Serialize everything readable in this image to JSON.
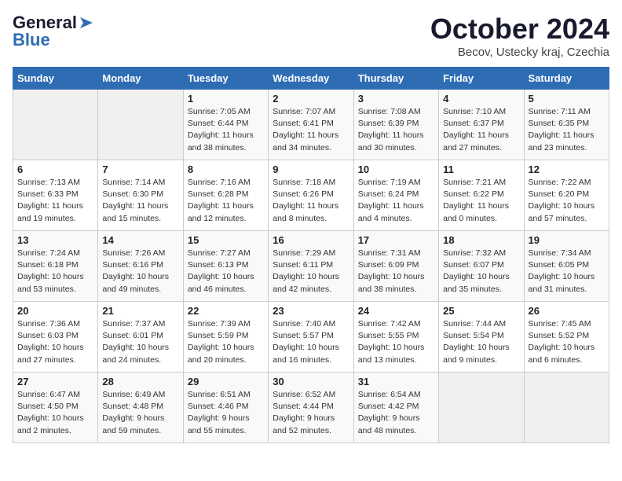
{
  "header": {
    "logo_line1": "General",
    "logo_line2": "Blue",
    "title": "October 2024",
    "subtitle": "Becov, Ustecky kraj, Czechia"
  },
  "days_of_week": [
    "Sunday",
    "Monday",
    "Tuesday",
    "Wednesday",
    "Thursday",
    "Friday",
    "Saturday"
  ],
  "weeks": [
    [
      {
        "day": "",
        "info": ""
      },
      {
        "day": "",
        "info": ""
      },
      {
        "day": "1",
        "info": "Sunrise: 7:05 AM\nSunset: 6:44 PM\nDaylight: 11 hours and 38 minutes."
      },
      {
        "day": "2",
        "info": "Sunrise: 7:07 AM\nSunset: 6:41 PM\nDaylight: 11 hours and 34 minutes."
      },
      {
        "day": "3",
        "info": "Sunrise: 7:08 AM\nSunset: 6:39 PM\nDaylight: 11 hours and 30 minutes."
      },
      {
        "day": "4",
        "info": "Sunrise: 7:10 AM\nSunset: 6:37 PM\nDaylight: 11 hours and 27 minutes."
      },
      {
        "day": "5",
        "info": "Sunrise: 7:11 AM\nSunset: 6:35 PM\nDaylight: 11 hours and 23 minutes."
      }
    ],
    [
      {
        "day": "6",
        "info": "Sunrise: 7:13 AM\nSunset: 6:33 PM\nDaylight: 11 hours and 19 minutes."
      },
      {
        "day": "7",
        "info": "Sunrise: 7:14 AM\nSunset: 6:30 PM\nDaylight: 11 hours and 15 minutes."
      },
      {
        "day": "8",
        "info": "Sunrise: 7:16 AM\nSunset: 6:28 PM\nDaylight: 11 hours and 12 minutes."
      },
      {
        "day": "9",
        "info": "Sunrise: 7:18 AM\nSunset: 6:26 PM\nDaylight: 11 hours and 8 minutes."
      },
      {
        "day": "10",
        "info": "Sunrise: 7:19 AM\nSunset: 6:24 PM\nDaylight: 11 hours and 4 minutes."
      },
      {
        "day": "11",
        "info": "Sunrise: 7:21 AM\nSunset: 6:22 PM\nDaylight: 11 hours and 0 minutes."
      },
      {
        "day": "12",
        "info": "Sunrise: 7:22 AM\nSunset: 6:20 PM\nDaylight: 10 hours and 57 minutes."
      }
    ],
    [
      {
        "day": "13",
        "info": "Sunrise: 7:24 AM\nSunset: 6:18 PM\nDaylight: 10 hours and 53 minutes."
      },
      {
        "day": "14",
        "info": "Sunrise: 7:26 AM\nSunset: 6:16 PM\nDaylight: 10 hours and 49 minutes."
      },
      {
        "day": "15",
        "info": "Sunrise: 7:27 AM\nSunset: 6:13 PM\nDaylight: 10 hours and 46 minutes."
      },
      {
        "day": "16",
        "info": "Sunrise: 7:29 AM\nSunset: 6:11 PM\nDaylight: 10 hours and 42 minutes."
      },
      {
        "day": "17",
        "info": "Sunrise: 7:31 AM\nSunset: 6:09 PM\nDaylight: 10 hours and 38 minutes."
      },
      {
        "day": "18",
        "info": "Sunrise: 7:32 AM\nSunset: 6:07 PM\nDaylight: 10 hours and 35 minutes."
      },
      {
        "day": "19",
        "info": "Sunrise: 7:34 AM\nSunset: 6:05 PM\nDaylight: 10 hours and 31 minutes."
      }
    ],
    [
      {
        "day": "20",
        "info": "Sunrise: 7:36 AM\nSunset: 6:03 PM\nDaylight: 10 hours and 27 minutes."
      },
      {
        "day": "21",
        "info": "Sunrise: 7:37 AM\nSunset: 6:01 PM\nDaylight: 10 hours and 24 minutes."
      },
      {
        "day": "22",
        "info": "Sunrise: 7:39 AM\nSunset: 5:59 PM\nDaylight: 10 hours and 20 minutes."
      },
      {
        "day": "23",
        "info": "Sunrise: 7:40 AM\nSunset: 5:57 PM\nDaylight: 10 hours and 16 minutes."
      },
      {
        "day": "24",
        "info": "Sunrise: 7:42 AM\nSunset: 5:55 PM\nDaylight: 10 hours and 13 minutes."
      },
      {
        "day": "25",
        "info": "Sunrise: 7:44 AM\nSunset: 5:54 PM\nDaylight: 10 hours and 9 minutes."
      },
      {
        "day": "26",
        "info": "Sunrise: 7:45 AM\nSunset: 5:52 PM\nDaylight: 10 hours and 6 minutes."
      }
    ],
    [
      {
        "day": "27",
        "info": "Sunrise: 6:47 AM\nSunset: 4:50 PM\nDaylight: 10 hours and 2 minutes."
      },
      {
        "day": "28",
        "info": "Sunrise: 6:49 AM\nSunset: 4:48 PM\nDaylight: 9 hours and 59 minutes."
      },
      {
        "day": "29",
        "info": "Sunrise: 6:51 AM\nSunset: 4:46 PM\nDaylight: 9 hours and 55 minutes."
      },
      {
        "day": "30",
        "info": "Sunrise: 6:52 AM\nSunset: 4:44 PM\nDaylight: 9 hours and 52 minutes."
      },
      {
        "day": "31",
        "info": "Sunrise: 6:54 AM\nSunset: 4:42 PM\nDaylight: 9 hours and 48 minutes."
      },
      {
        "day": "",
        "info": ""
      },
      {
        "day": "",
        "info": ""
      }
    ]
  ]
}
